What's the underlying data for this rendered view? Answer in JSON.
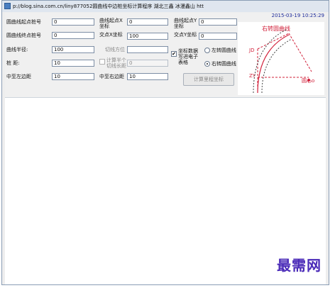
{
  "window": {
    "title": "p://blog.sina.com.cn/liny877052圆曲线中边桩坐标计算程序   湖北三鑫   冰漫鑫山   htt"
  },
  "header": {
    "datetime": "2015-03-19 10:25:29"
  },
  "form": {
    "circle_start_station": {
      "label": "圆曲线起点桩号",
      "value": "0"
    },
    "circle_end_station": {
      "label": "圆曲线终点桩号",
      "value": "0"
    },
    "curve_radius": {
      "label": "曲线半径:",
      "value": "100"
    },
    "station": {
      "label": "桩   距:",
      "value": "10"
    },
    "center_left_width": {
      "label": "中至左边距",
      "value": "10"
    },
    "start_x": {
      "label": "曲线起点X坐标",
      "value": "0"
    },
    "intersection_x": {
      "label": "交点X坐标",
      "value": "100"
    },
    "tangent_bearing": {
      "label": "切线方位",
      "value": ""
    },
    "calc_by_half": {
      "label": "计算半个切线长距",
      "value": "0"
    },
    "center_right_width": {
      "label": "中至右边距",
      "value": "10"
    },
    "start_y": {
      "label": "曲线起点Y坐标",
      "value": "0"
    },
    "intersection_y": {
      "label": "交点Y坐标",
      "value": "0"
    },
    "export_excel": {
      "label": "坐标数据写进电子表格",
      "checked": "✔"
    },
    "left_curve": {
      "label": "左转圆曲线"
    },
    "right_curve": {
      "label": "右转圆曲线"
    },
    "compute_button": {
      "label": "计算里程坐标"
    }
  },
  "diagram": {
    "title": "右转圆曲线",
    "jd": "JD",
    "zy": "ZY",
    "center": "圆心o",
    "color": "#d1203a"
  },
  "watermark": {
    "text": "最需网"
  }
}
